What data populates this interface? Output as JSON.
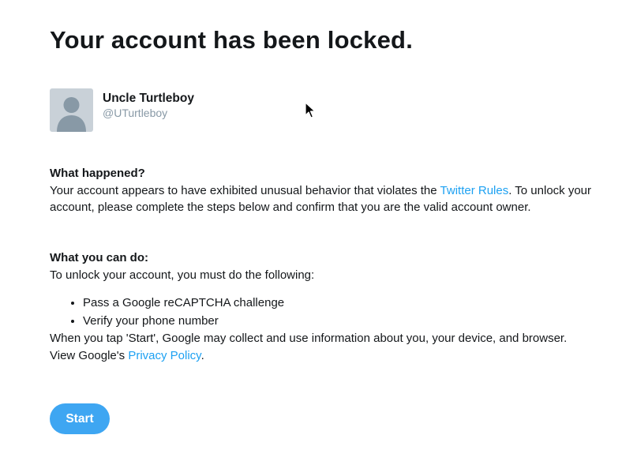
{
  "page": {
    "title": "Your account has been locked."
  },
  "account": {
    "display_name": "Uncle Turtleboy",
    "handle": "@UTurtleboy",
    "avatar_icon": "default-avatar-icon"
  },
  "what_happened": {
    "heading": "What happened?",
    "text_before_link": "Your account appears to have exhibited unusual behavior that violates the ",
    "link_text": "Twitter Rules",
    "text_after_link": ". To unlock your account, please complete the steps below and confirm that you are the valid account owner."
  },
  "what_you_can_do": {
    "heading": "What you can do:",
    "intro": "To unlock your account, you must do the following:",
    "steps": [
      "Pass a Google reCAPTCHA challenge",
      "Verify your phone number"
    ],
    "disclaimer_before_link": "When you tap 'Start', Google may collect and use information about you, your device, and browser. View Google's ",
    "disclaimer_link": "Privacy Policy",
    "disclaimer_after_link": "."
  },
  "actions": {
    "start_label": "Start"
  },
  "colors": {
    "link": "#1da1f2",
    "button": "#3ea6f2",
    "handle": "#8899a6",
    "avatar_bg": "#c9d1d8"
  }
}
